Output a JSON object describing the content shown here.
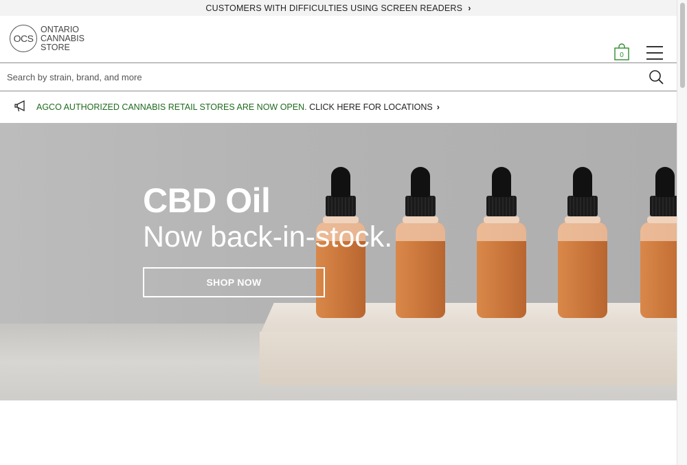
{
  "accessibility_bar": {
    "text": "CUSTOMERS WITH DIFFICULTIES USING SCREEN READERS",
    "chevron": "›"
  },
  "header": {
    "logo": {
      "mark": "OCS",
      "line1": "ONTARIO",
      "line2": "CANNABIS",
      "line3": "STORE"
    },
    "cart_count": "0",
    "cart_icon": "shopping-bag-icon",
    "menu_icon": "hamburger-menu-icon"
  },
  "search": {
    "placeholder": "Search by strain, brand, and more",
    "value": "",
    "icon": "search-icon"
  },
  "announcement": {
    "icon": "megaphone-icon",
    "highlight": "AGCO AUTHORIZED CANNABIS RETAIL STORES ARE NOW OPEN.",
    "link": "CLICK HERE FOR LOCATIONS",
    "chevron": "›"
  },
  "hero": {
    "title": "CBD Oil",
    "subtitle": "Now back-in-stock.",
    "cta_label": "SHOP NOW"
  },
  "colors": {
    "accent_green": "#1e6a1e",
    "cart_green": "#2e8b2e",
    "hero_text": "#ffffff"
  }
}
